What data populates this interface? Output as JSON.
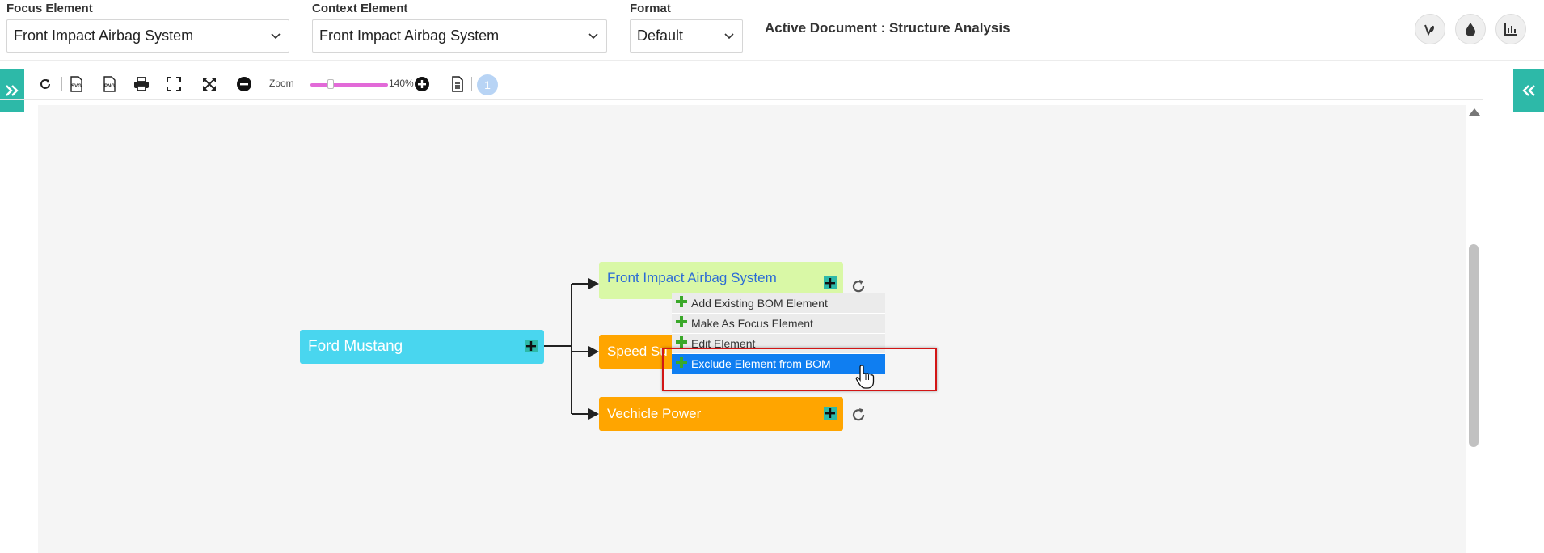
{
  "header": {
    "focus": {
      "label": "Focus Element",
      "value": "Front Impact Airbag System"
    },
    "context": {
      "label": "Context Element",
      "value": "Front Impact Airbag System"
    },
    "format": {
      "label": "Format",
      "value": "Default"
    },
    "active_document": "Active Document : Structure Analysis",
    "buttons": [
      "vine-icon",
      "drop-icon",
      "chart-icon"
    ]
  },
  "toolbar": {
    "zoom_label": "Zoom",
    "zoom_value": "140%",
    "badge": "1"
  },
  "diagram": {
    "root": "Ford Mustang",
    "children": [
      {
        "label": "Front Impact Airbag System",
        "color": "#d9f8a6",
        "text_color": "#2b6bd6"
      },
      {
        "label": "Speed Su",
        "color": "#ffa500",
        "text_color": "#ffffff"
      },
      {
        "label": "Vechicle Power",
        "color": "#ffa500",
        "text_color": "#ffffff"
      }
    ],
    "root_color": "#49d6ef"
  },
  "context_menu": {
    "items": [
      {
        "label": "Add Existing BOM Element"
      },
      {
        "label": "Make As Focus Element"
      },
      {
        "label": "Edit Element"
      },
      {
        "label": "Exclude Element from BOM"
      }
    ]
  }
}
